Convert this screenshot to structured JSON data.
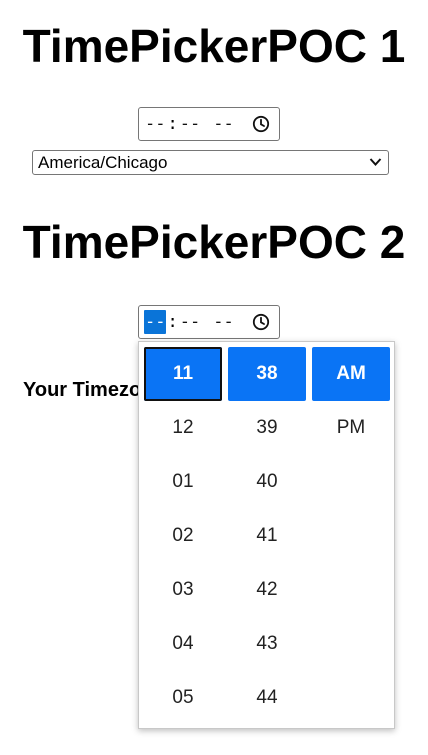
{
  "sections": [
    {
      "title": "TimePickerPOC 1",
      "time_input": {
        "hour": "--",
        "minute": "--",
        "meridiem": "--",
        "separator": ":"
      },
      "timezone_select": {
        "selected": "America/Chicago"
      }
    },
    {
      "title": "TimePickerPOC 2",
      "time_input": {
        "hour": "--",
        "minute": "--",
        "meridiem": "--",
        "separator": ":",
        "focused_segment": "hour"
      },
      "timezone_label": "Your Timezone"
    }
  ],
  "picker": {
    "hours": [
      "11",
      "12",
      "01",
      "02",
      "03",
      "04",
      "05"
    ],
    "minutes": [
      "38",
      "39",
      "40",
      "41",
      "42",
      "43",
      "44"
    ],
    "meridiem": [
      "AM",
      "PM"
    ],
    "selected": {
      "hour": "11",
      "minute": "38",
      "meridiem": "AM"
    }
  },
  "colors": {
    "accent": "#0a74f5",
    "segment_highlight": "#0a74d8",
    "border": "#767676"
  },
  "icons": {
    "clock": "clock-icon",
    "chevron": "chevron-down-icon"
  }
}
